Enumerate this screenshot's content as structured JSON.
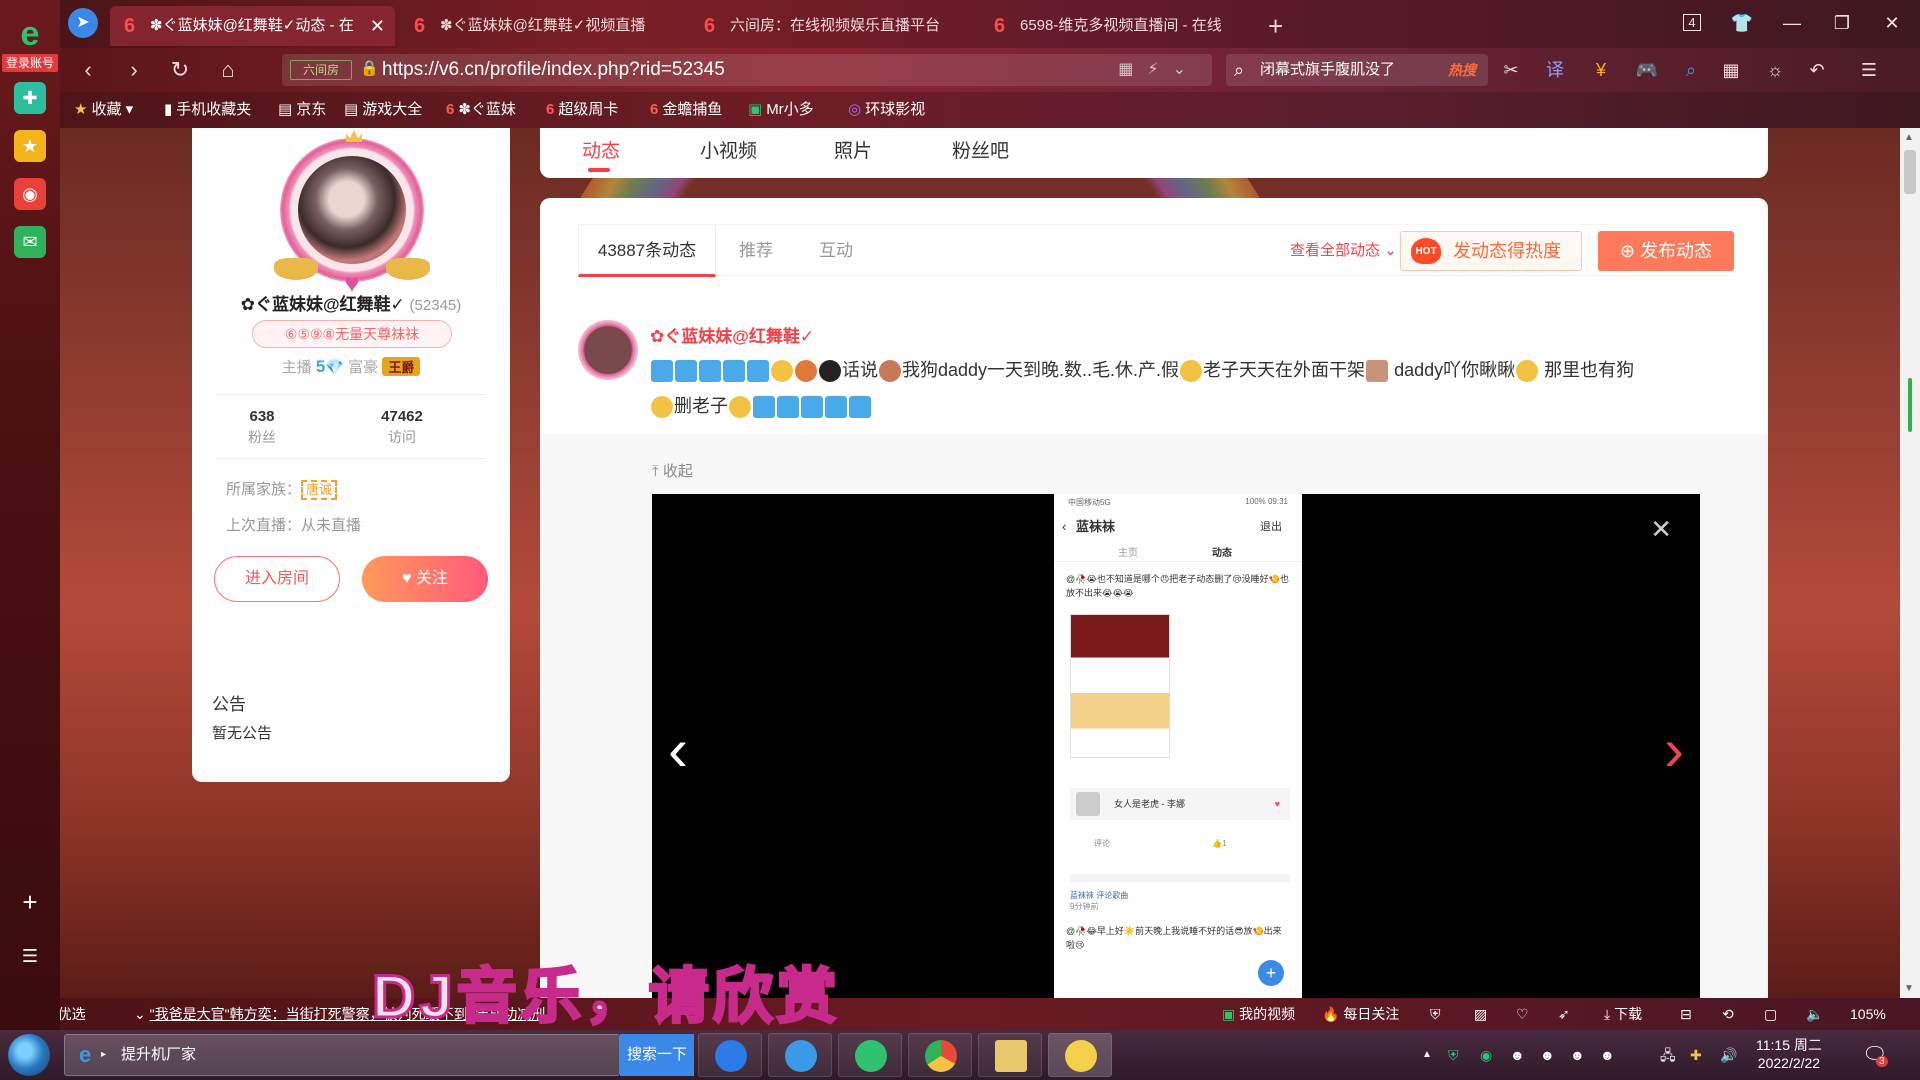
{
  "browser": {
    "login_label": "登录账号",
    "tabs": [
      {
        "title": "✽ぐ蓝妹妹@红舞鞋✓动态 - 在",
        "active": true
      },
      {
        "title": "✽ぐ蓝妹妹@红舞鞋✓视频直播",
        "active": false
      },
      {
        "title": "六间房：在线视频娱乐直播平台",
        "active": false
      },
      {
        "title": "6598-维克多视频直播间 - 在线",
        "active": false
      }
    ],
    "tab_count": "4",
    "url_site_label": "六间房",
    "url": "https://v6.cn/profile/index.php?rid=52345",
    "search_placeholder": "闭幕式旗手腹肌没了",
    "search_hot": "热搜",
    "bookmarks": [
      {
        "label": "收藏",
        "icon": "star"
      },
      {
        "label": "手机收藏夹",
        "icon": "phone"
      },
      {
        "label": "京东",
        "icon": "doc"
      },
      {
        "label": "游戏大全",
        "icon": "doc"
      },
      {
        "label": "✽ぐ蓝妹",
        "icon": "six"
      },
      {
        "label": "超级周卡",
        "icon": "six"
      },
      {
        "label": "金蟾捕鱼",
        "icon": "six"
      },
      {
        "label": "Mr小多",
        "icon": "green"
      },
      {
        "label": "环球影视",
        "icon": "circle"
      }
    ]
  },
  "profile": {
    "name": "✿ぐ蓝妹妹@红舞鞋✓",
    "rid": "(52345)",
    "badge": "⑥⑤⑨⑧无量天尊袜袜",
    "anchor_label": "主播",
    "anchor_level": "5",
    "rich_label": "富豪",
    "rich_tag": "王爵",
    "fans_count": "638",
    "fans_label": "粉丝",
    "visits_count": "47462",
    "visits_label": "访问",
    "family_label": "所属家族：",
    "family_tag": "唐诚",
    "last_live": "上次直播：从未直播",
    "enter_room": "进入房间",
    "follow": "关注"
  },
  "notice": {
    "title": "公告",
    "text": "暂无公告"
  },
  "page_tabs": [
    "动态",
    "小视频",
    "照片",
    "粉丝吧"
  ],
  "feed": {
    "subtabs": [
      "43887条动态",
      "推荐",
      "互动"
    ],
    "view_all": "查看全部动态",
    "hot_button": "发动态得热度",
    "hot_icon_text": "HOT",
    "publish_button": "发布动态",
    "post": {
      "author": "✿ぐ蓝妹妹@红舞鞋✓",
      "text_1": "话说",
      "text_2": "我狗daddy一天到晚.数..毛.休.产.假",
      "text_3": "老子天天在外面干架",
      "text_4": " daddy吖你瞅瞅",
      "text_5": " 那里也有狗",
      "text_6": "删老子",
      "collapse": "收起"
    },
    "phone": {
      "status_left": "中国移动5G",
      "status_right": "100% 09:31",
      "title": "蓝袜袜",
      "exit": "退出",
      "tab_home": "主页",
      "tab_feed": "动态",
      "post1": "@🥀😭也不知道是哪个😠把老子动态删了😢没睡好🍤也放不出来😭😭😭",
      "song": "女人是老虎 - 李娜",
      "comment": "评论",
      "likes": "1",
      "comment_user": "蓝袜袜 评论歌曲",
      "comment_time": "9分钟前",
      "post2": "@🥀😂早上好☀️前天晚上我说睡不好的话😎放🍤出来啦😢"
    }
  },
  "overlay_text": "DJ音乐，请欣赏",
  "statusbar": {
    "today": "今日优选",
    "news": "\"我爸是大官\"韩方奕：当街打死警察，被判死缓不到7年成功减刑",
    "my_video": "我的视频",
    "daily": "每日关注",
    "download": "下载",
    "zoom": "105%"
  },
  "taskbar": {
    "task_label": "提升机厂家",
    "search_btn": "搜索一下",
    "time": "11:15 周二",
    "date": "2022/2/22",
    "notif_count": "3"
  },
  "colors": {
    "accent_red": "#f5404a",
    "hot_orange": "#ff6a3a",
    "follow_gradient_start": "#ff9a5a",
    "follow_gradient_end": "#ff5a7a"
  }
}
